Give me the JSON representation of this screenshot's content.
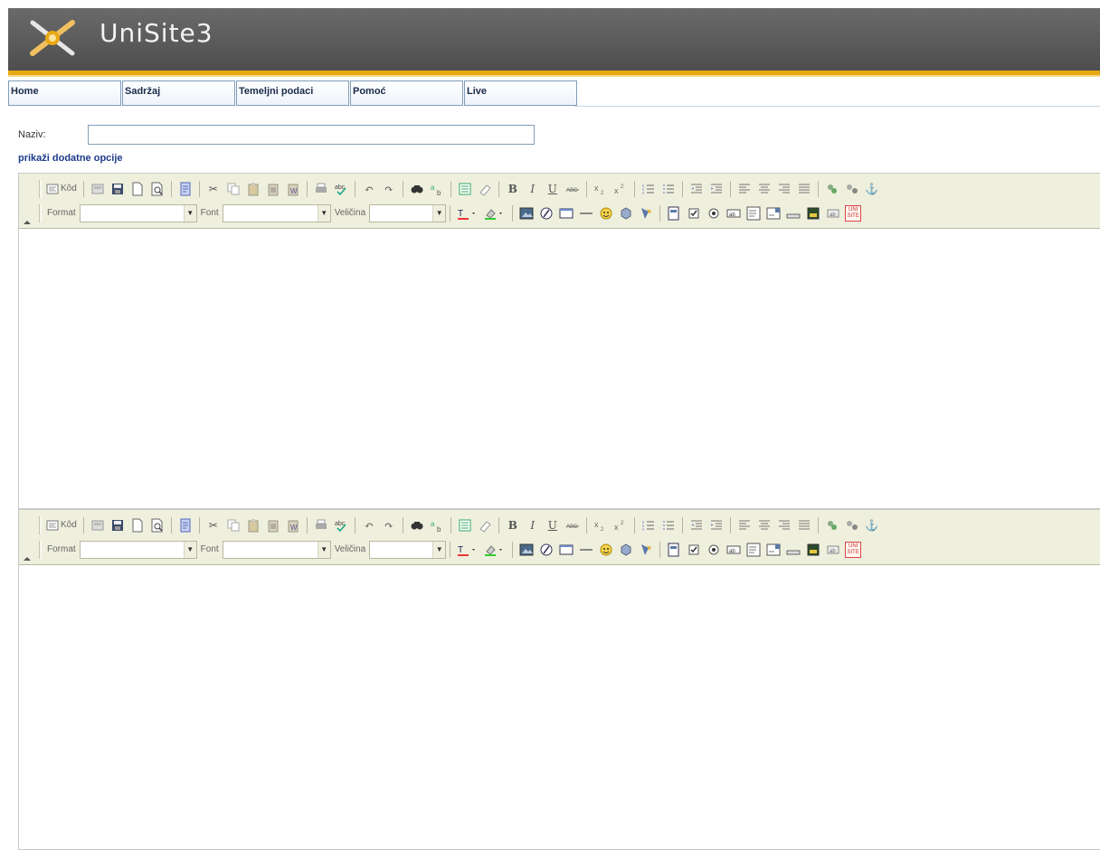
{
  "app": {
    "title": "UniSite3"
  },
  "nav": {
    "tabs": [
      {
        "label": "Home"
      },
      {
        "label": "Sadržaj"
      },
      {
        "label": "Temeljni podaci"
      },
      {
        "label": "Pomoć"
      },
      {
        "label": "Live"
      }
    ]
  },
  "form": {
    "name_label": "Naziv:",
    "name_value": "",
    "more_options": "prikaži dodatne opcije"
  },
  "editor": {
    "source_label": "Kôd",
    "format_label": "Format",
    "font_label": "Font",
    "size_label": "Veličina",
    "format_value": "",
    "font_value": "",
    "size_value": "",
    "uni_badge": "UNI SITE"
  },
  "colors": {
    "header_bg": "#5a5a5a",
    "accent": "#e8a813",
    "toolbar_bg": "#efefde",
    "link": "#1d3b8c"
  }
}
